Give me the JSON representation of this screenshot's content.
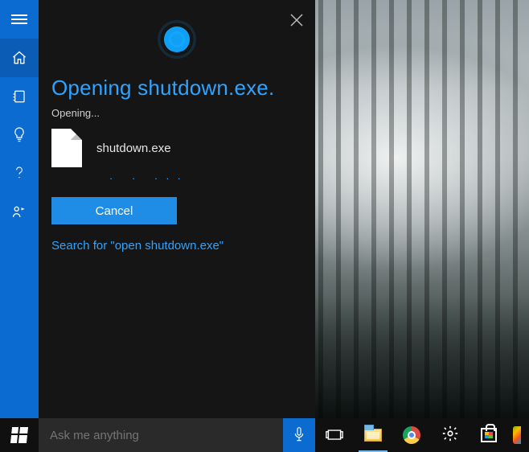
{
  "colors": {
    "accent_blue": "#0b6bd1",
    "link_blue": "#2ea3ff",
    "button_blue": "#1f8ce6"
  },
  "rail": {
    "items": [
      {
        "name": "menu-icon"
      },
      {
        "name": "home-icon",
        "active": true
      },
      {
        "name": "notebook-icon"
      },
      {
        "name": "lightbulb-icon"
      },
      {
        "name": "help-icon"
      },
      {
        "name": "feedback-icon"
      }
    ]
  },
  "cortana": {
    "heading": "Opening shutdown.exe.",
    "status": "Opening...",
    "file_name": "shutdown.exe",
    "progress_dots": "·   ·   ···",
    "cancel_label": "Cancel",
    "search_link": "Search for \"open shutdown.exe\""
  },
  "taskbar": {
    "search_placeholder": "Ask me anything",
    "search_value": "",
    "icons": [
      {
        "name": "task-view-icon"
      },
      {
        "name": "file-explorer-icon",
        "active": true
      },
      {
        "name": "chrome-icon"
      },
      {
        "name": "settings-icon"
      },
      {
        "name": "store-icon"
      },
      {
        "name": "partial-app-icon"
      }
    ]
  }
}
